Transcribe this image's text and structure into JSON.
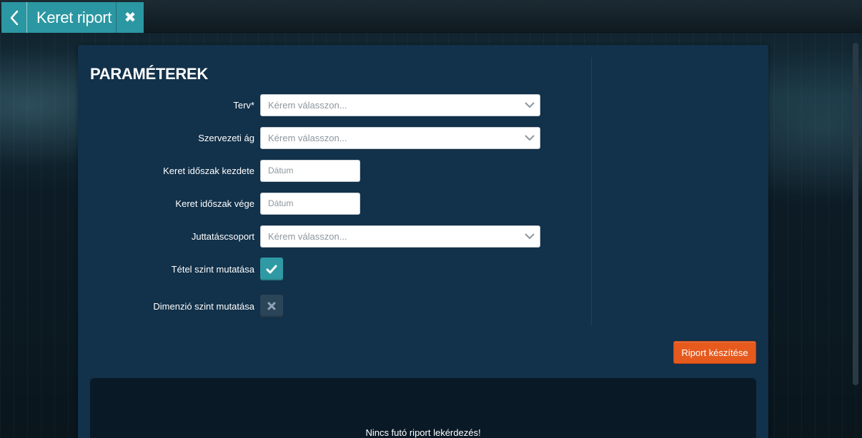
{
  "header": {
    "title": "Keret riport"
  },
  "params": {
    "heading": "PARAMÉTEREK",
    "fields": [
      {
        "label": "Terv*",
        "placeholder": "Kérem válasszon..."
      },
      {
        "label": "Szervezeti ág",
        "placeholder": "Kérem válasszon..."
      },
      {
        "label": "Keret időszak kezdete",
        "placeholder": "Dátum"
      },
      {
        "label": "Keret időszak vége",
        "placeholder": "Dátum"
      },
      {
        "label": "Juttatáscsoport",
        "placeholder": "Kérem válasszon..."
      },
      {
        "label": "Tétel szint mutatása",
        "checked": true
      },
      {
        "label": "Dimenzió szint mutatása",
        "checked": false
      }
    ],
    "submit_label": "Riport készítése"
  },
  "result": {
    "empty_text": "Nincs futó riport lekérdezés!"
  },
  "colors": {
    "accent": "#2b97a2",
    "button": "#e65a1e",
    "panel": "#12314a"
  }
}
